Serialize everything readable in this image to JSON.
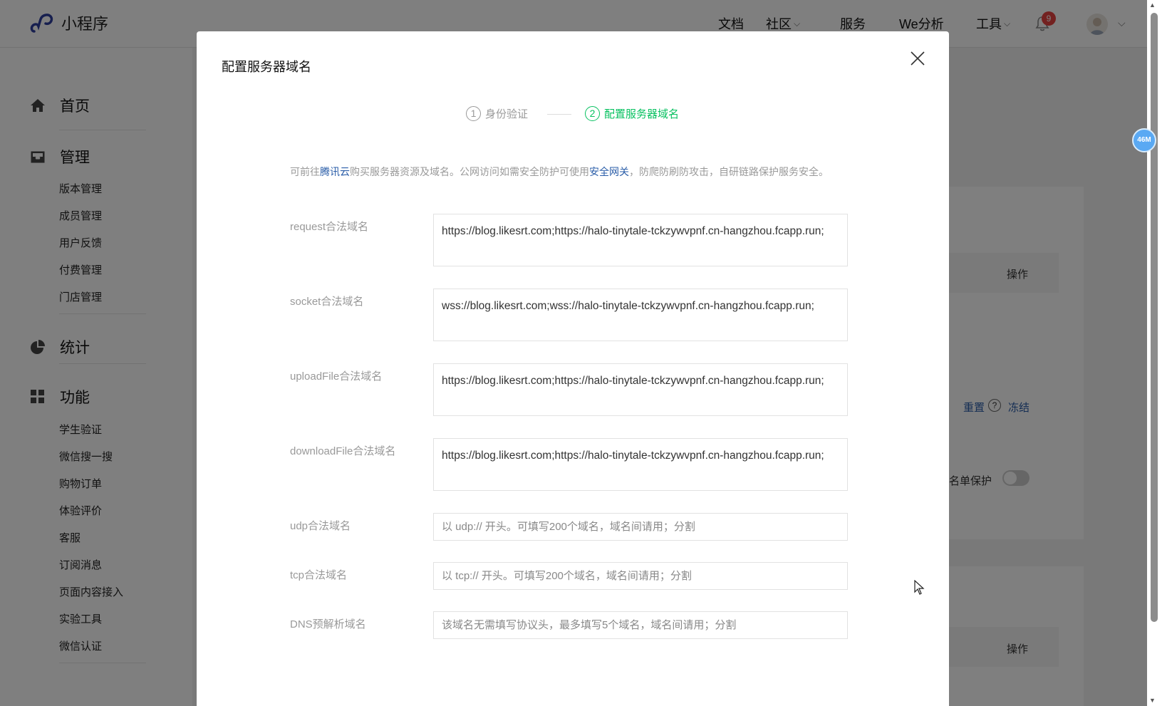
{
  "app": {
    "name": "小程序",
    "brand_color": "#2f3e9e"
  },
  "topnav": {
    "items": [
      {
        "label": "文档",
        "dropdown": false
      },
      {
        "label": "社区",
        "dropdown": true
      },
      {
        "label": "服务",
        "dropdown": false
      },
      {
        "label": "We分析",
        "dropdown": false
      },
      {
        "label": "工具",
        "dropdown": true
      }
    ],
    "notifications": "9"
  },
  "sidebar": {
    "groups": [
      {
        "label": "首页",
        "icon": "home-icon",
        "items": []
      },
      {
        "label": "管理",
        "icon": "inbox-icon",
        "items": [
          "版本管理",
          "成员管理",
          "用户反馈",
          "付费管理",
          "门店管理"
        ]
      },
      {
        "label": "统计",
        "icon": "pie-chart-icon",
        "items": []
      },
      {
        "label": "功能",
        "icon": "grid-icon",
        "items": [
          "学生验证",
          "微信搜一搜",
          "购物订单",
          "体验评价",
          "客服",
          "订阅消息",
          "页面内容接入",
          "实验工具",
          "微信认证"
        ]
      }
    ]
  },
  "background": {
    "op_label_1": "操作",
    "reset_link": "重置",
    "freeze_link": "冻结",
    "whitelist_label": "名单保护",
    "op_label_2": "操作"
  },
  "scroll": {
    "memory_badge": "46M"
  },
  "dialog": {
    "title": "配置服务器域名",
    "steps": [
      {
        "num": "1",
        "label": "身份验证",
        "state": "done"
      },
      {
        "num": "2",
        "label": "配置服务器域名",
        "state": "active"
      }
    ],
    "notice": {
      "p1": "可前往",
      "link1": "腾讯云",
      "p2": "购买服务器资源及域名。公网访问如需安全防护可使用",
      "link2": "安全网关",
      "p3": "，防爬防刷防攻击，自研链路保护服务安全。"
    },
    "fields": {
      "request": {
        "label": "request合法域名",
        "value": "https://blog.likesrt.com;https://halo-tinytale-tckzywvpnf.cn-hangzhou.fcapp.run;"
      },
      "socket": {
        "label": "socket合法域名",
        "value": "wss://blog.likesrt.com;wss://halo-tinytale-tckzywvpnf.cn-hangzhou.fcapp.run;"
      },
      "uploadFile": {
        "label": "uploadFile合法域名",
        "value": "https://blog.likesrt.com;https://halo-tinytale-tckzywvpnf.cn-hangzhou.fcapp.run;"
      },
      "downloadFile": {
        "label": "downloadFile合法域名",
        "value": "https://blog.likesrt.com;https://halo-tinytale-tckzywvpnf.cn-hangzhou.fcapp.run;"
      },
      "udp": {
        "label": "udp合法域名",
        "value": "",
        "placeholder": "以 udp:// 开头。可填写200个域名，域名间请用；分割"
      },
      "tcp": {
        "label": "tcp合法域名",
        "value": "",
        "placeholder": "以 tcp:// 开头。可填写200个域名，域名间请用；分割"
      },
      "dns": {
        "label": "DNS预解析域名",
        "value": "",
        "placeholder": "该域名无需填写协议头，最多填写5个域名，域名间请用；分割"
      }
    },
    "accent_color": "#07c160",
    "link_color": "#2a5da8"
  }
}
